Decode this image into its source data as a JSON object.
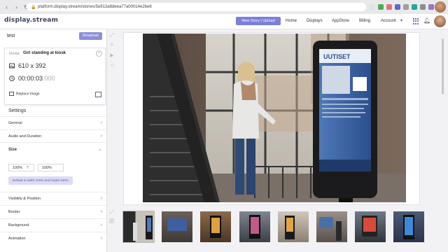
{
  "browser": {
    "url": "platform.display.stream/stories/5e813a8deea77a00014e2be6"
  },
  "header": {
    "logo": "display.stream",
    "new_story_button": "New Story | Upload",
    "nav": [
      "Home",
      "Displays",
      "AppStore",
      "Billing",
      "Account"
    ]
  },
  "story": {
    "title": "test",
    "broadcast_button": "Broadcast"
  },
  "media": {
    "label": "Media",
    "name": "Girl standing at kiosk",
    "dimensions": "610 x 392",
    "duration_main": "00:00:03",
    "duration_ms": ".000",
    "replace_label": "Replace Image"
  },
  "settings": {
    "title": "Settings",
    "rows": [
      "General",
      "Audio and Duration"
    ],
    "size": {
      "label": "Size",
      "width_value": "100%",
      "height_value": "100%",
      "default_button": "Default is width 100% and height 100%"
    },
    "rows_after": [
      "Visibility & Position",
      "Border",
      "Background",
      "Animation"
    ]
  },
  "colors": {
    "accent": "#7c7fd8",
    "broadcast": "#8b8ed9",
    "logo": "#3b3f5c"
  },
  "thumbnails": [
    "kiosk-girl",
    "kiosk-tv",
    "kiosk-shop",
    "kiosk-street",
    "kiosk-tower",
    "kiosk-mall",
    "kiosk-station",
    "kiosk-blue"
  ]
}
